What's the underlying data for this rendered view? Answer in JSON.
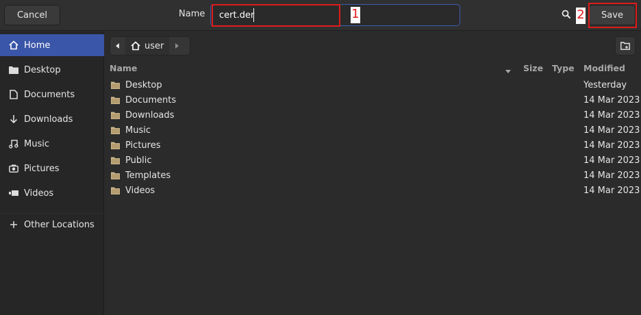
{
  "header": {
    "cancel_label": "Cancel",
    "name_label": "Name",
    "filename_value": "cert.der",
    "save_label": "Save",
    "annotation_1": "1",
    "annotation_2": "2"
  },
  "sidebar": {
    "items": [
      {
        "label": "Home",
        "icon": "home-icon"
      },
      {
        "label": "Desktop",
        "icon": "folder-icon"
      },
      {
        "label": "Documents",
        "icon": "document-icon"
      },
      {
        "label": "Downloads",
        "icon": "download-icon"
      },
      {
        "label": "Music",
        "icon": "music-icon"
      },
      {
        "label": "Pictures",
        "icon": "camera-icon"
      },
      {
        "label": "Videos",
        "icon": "video-icon"
      },
      {
        "label": "Other Locations",
        "icon": "plus-icon"
      }
    ]
  },
  "pathbar": {
    "current": "user"
  },
  "columns": {
    "name": "Name",
    "size": "Size",
    "type": "Type",
    "modified": "Modified"
  },
  "files": [
    {
      "name": "Desktop",
      "modified": "Yesterday"
    },
    {
      "name": "Documents",
      "modified": "14 Mar 2023"
    },
    {
      "name": "Downloads",
      "modified": "14 Mar 2023"
    },
    {
      "name": "Music",
      "modified": "14 Mar 2023"
    },
    {
      "name": "Pictures",
      "modified": "14 Mar 2023"
    },
    {
      "name": "Public",
      "modified": "14 Mar 2023"
    },
    {
      "name": "Templates",
      "modified": "14 Mar 2023"
    },
    {
      "name": "Videos",
      "modified": "14 Mar 2023"
    }
  ],
  "colors": {
    "accent": "#3a56a8",
    "annotation": "#e01b1b",
    "folder": "#c9b48a"
  }
}
